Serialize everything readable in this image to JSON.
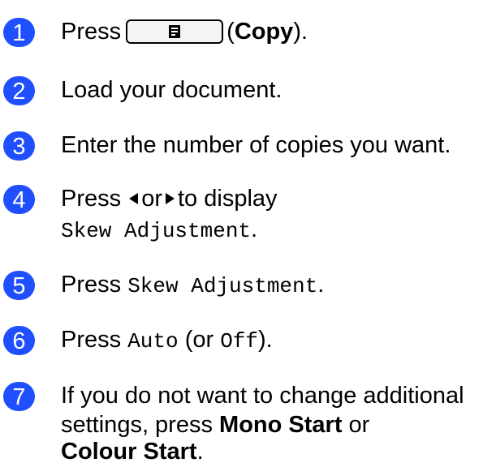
{
  "accent_color": "#1f4fff",
  "steps": [
    {
      "number": "1",
      "press": "Press",
      "key_icon": "copy-document-icon",
      "open_paren": "(",
      "key_label": "Copy",
      "close": ")."
    },
    {
      "number": "2",
      "text": "Load your document."
    },
    {
      "number": "3",
      "text": "Enter the number of copies you want."
    },
    {
      "number": "4",
      "press": "Press",
      "left_arrow": "left-arrow-icon",
      "or": "or",
      "right_arrow": "right-arrow-icon",
      "to_display": "to display",
      "menu_item": "Skew Adjustment",
      "period": "."
    },
    {
      "number": "5",
      "press": "Press",
      "menu_item": "Skew Adjustment",
      "period": "."
    },
    {
      "number": "6",
      "press": "Press",
      "option_auto": "Auto",
      "or_open": "(or",
      "option_off": "Off",
      "close": ")."
    },
    {
      "number": "7",
      "line1": "If you do not want to change additional",
      "line2_prefix": "settings, press",
      "mono_start": "Mono Start",
      "or": "or",
      "colour_start": "Colour Start",
      "period": "."
    }
  ]
}
